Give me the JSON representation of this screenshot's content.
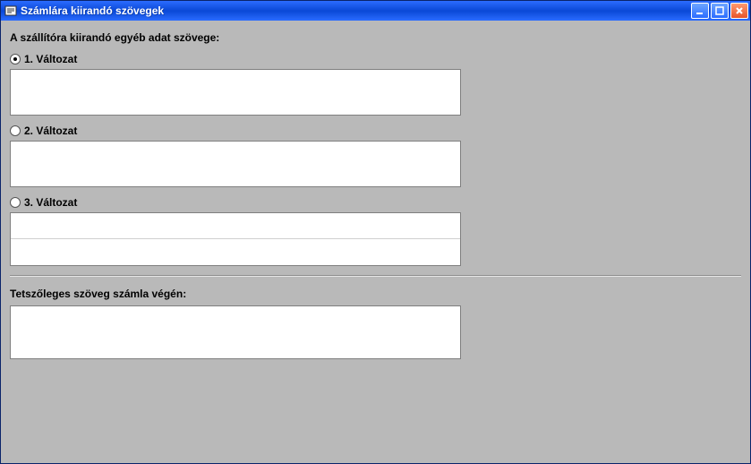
{
  "window": {
    "title": "Számlára kiirandó szövegek"
  },
  "labels": {
    "header": "A szállítóra kiirandó egyéb adat szövege:",
    "footer": "Tetszőleges szöveg számla végén:"
  },
  "variants": [
    {
      "label": "1. Változat",
      "checked": true,
      "value": ""
    },
    {
      "label": "2. Változat",
      "checked": false,
      "value": ""
    },
    {
      "label": "3. Változat",
      "checked": false,
      "value": ""
    }
  ],
  "footer_text": ""
}
